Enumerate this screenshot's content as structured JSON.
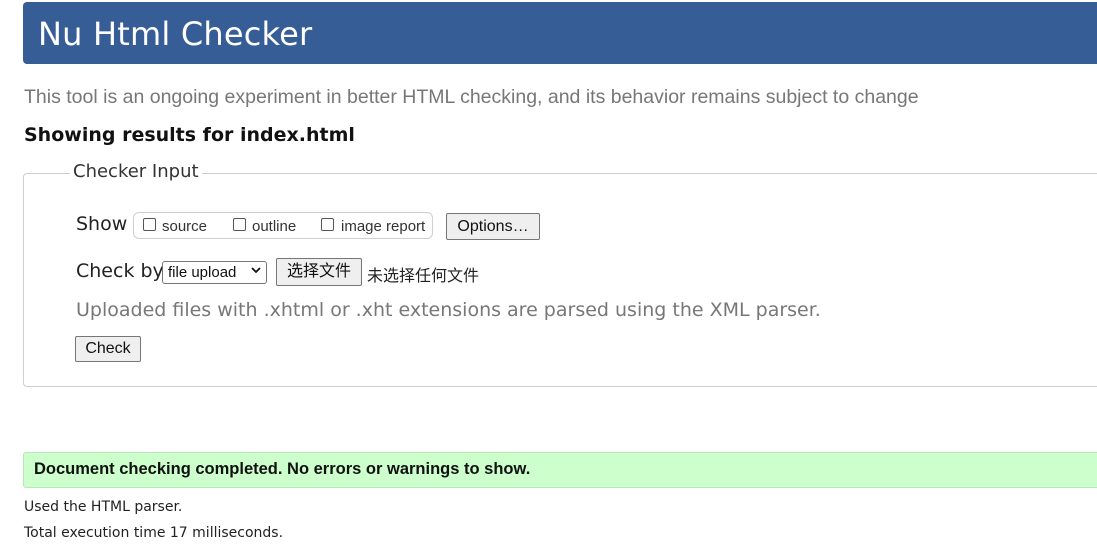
{
  "header": {
    "title": "Nu Html Checker"
  },
  "tagline": "This tool is an ongoing experiment in better HTML checking, and its behavior remains subject to change",
  "results_heading": "Showing results for index.html",
  "checker_input": {
    "legend": "Checker Input",
    "show_label": "Show",
    "show_options": [
      {
        "label": "source",
        "checked": false
      },
      {
        "label": "outline",
        "checked": false
      },
      {
        "label": "image report",
        "checked": false
      }
    ],
    "options_button": "Options…",
    "check_by_label": "Check by",
    "check_by_selected": "file upload",
    "choose_file_button": "选择文件",
    "file_status": "未选择任何文件",
    "hint": "Uploaded files with .xhtml or .xht extensions are parsed using the XML parser.",
    "check_button": "Check"
  },
  "result": {
    "message": "Document checking completed. No errors or warnings to show.",
    "parser_info": "Used the HTML parser.",
    "execution_time": "Total execution time 17 milliseconds."
  },
  "colors": {
    "banner": "#365d95",
    "success_bg": "#ccffcc",
    "tagline": "#777777"
  }
}
